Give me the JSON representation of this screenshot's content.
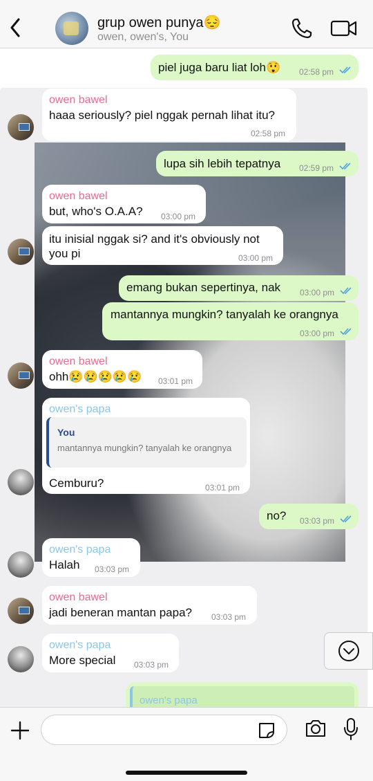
{
  "header": {
    "title": "grup owen punya😔",
    "subtitle": "owen, owen's, You"
  },
  "messages": [
    {
      "dir": "out",
      "text": "piel juga baru liat loh😲",
      "time": "02:58 pm"
    },
    {
      "dir": "in",
      "sender": "owen bawel",
      "text": "haaa seriously? piel nggak pernah lihat itu?",
      "time": "02:58 pm"
    },
    {
      "dir": "out",
      "text": "lupa sih lebih tepatnya",
      "time": "02:59 pm"
    },
    {
      "dir": "in",
      "sender": "owen bawel",
      "text": "but, who's O.A.A?",
      "time": "03:00 pm"
    },
    {
      "dir": "in",
      "text_line1": "itu inisial nggak si? and it's obviously not",
      "text_line2": "you pi",
      "time": "03:00 pm"
    },
    {
      "dir": "out",
      "text": "emang bukan sepertinya, nak",
      "time": "03:00 pm"
    },
    {
      "dir": "out",
      "text": "mantannya mungkin? tanyalah ke orangnya",
      "time": "03:00 pm"
    },
    {
      "dir": "in",
      "sender": "owen bawel",
      "text": "ohh😢😢😢😢😢",
      "time": "03:01 pm"
    },
    {
      "dir": "in",
      "sender": "owen's papa",
      "quote_name": "You",
      "quote_text": "mantannya mungkin? tanyalah ke orangnya",
      "text": "Cemburu?",
      "time": "03:01 pm"
    },
    {
      "dir": "out",
      "text": "no?",
      "time": "03:03 pm"
    },
    {
      "dir": "in",
      "sender": "owen's papa",
      "text": "Halah",
      "time": "03:03 pm"
    },
    {
      "dir": "in",
      "sender": "owen bawel",
      "text": "jadi beneran mantan papa?",
      "time": "03:03 pm"
    },
    {
      "dir": "in",
      "sender": "owen's papa",
      "text": "More special",
      "time": "03:03 pm"
    },
    {
      "dir": "out",
      "partial_sender": "owen's papa"
    }
  ],
  "input": {
    "value": "",
    "placeholder": ""
  },
  "icons": [
    "back-chevron-icon",
    "phone-icon",
    "video-camera-icon",
    "plus-icon",
    "sticker-icon",
    "camera-icon",
    "microphone-icon",
    "chevron-down-icon",
    "double-check-icon"
  ],
  "colors": {
    "outgoing_bubble": "#dcf8c6",
    "sender_bawel": "#ec6a8b",
    "sender_papa": "#8cc6e8",
    "read_ticks": "#4fa3e0",
    "quote_bar": "#2a4d8f"
  }
}
